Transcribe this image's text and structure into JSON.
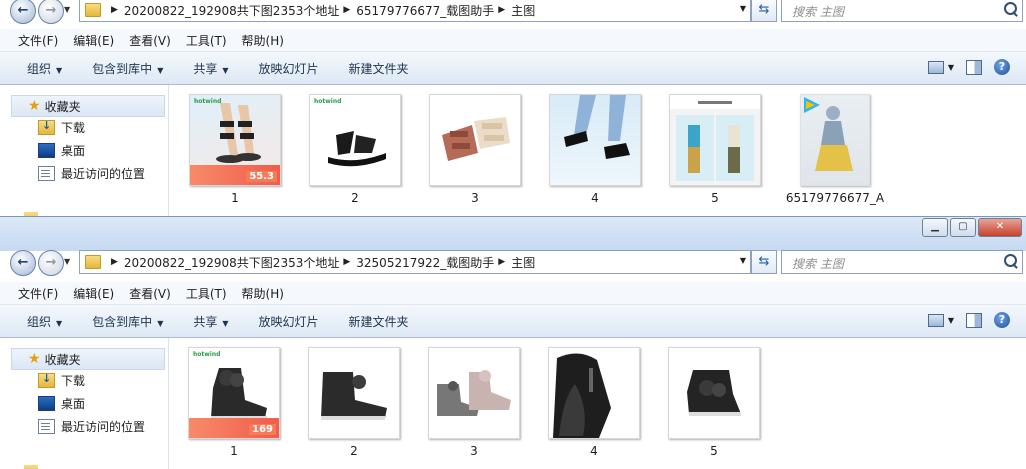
{
  "window_top": {
    "breadcrumbs": [
      "20200822_192908共下图2353个地址",
      "65179776677_载图助手",
      "主图"
    ],
    "search_placeholder": "搜索 主图",
    "menu": [
      "文件(F)",
      "编辑(E)",
      "查看(V)",
      "工具(T)",
      "帮助(H)"
    ],
    "toolbar": [
      "组织",
      "包含到库中",
      "共享",
      "放映幻灯片",
      "新建文件夹"
    ],
    "nav": {
      "favorites": "收藏夹",
      "items": [
        "下载",
        "桌面",
        "最近访问的位置"
      ]
    },
    "files": [
      {
        "label": "1",
        "thumb": "sandal-model-promo",
        "brand": "hotwind",
        "price": "55.3"
      },
      {
        "label": "2",
        "thumb": "sandal-black",
        "brand": "hotwind"
      },
      {
        "label": "3",
        "thumb": "sandal-pair"
      },
      {
        "label": "4",
        "thumb": "sandal-worn"
      },
      {
        "label": "5",
        "thumb": "model-collage"
      },
      {
        "label": "65179776677_A",
        "thumb": "video-file"
      }
    ]
  },
  "window_bottom": {
    "breadcrumbs": [
      "20200822_192908共下图2353个地址",
      "32505217922_载图助手",
      "主图"
    ],
    "search_placeholder": "搜索 主图",
    "menu": [
      "文件(F)",
      "编辑(E)",
      "查看(V)",
      "工具(T)",
      "帮助(H)"
    ],
    "toolbar": [
      "组织",
      "包含到库中",
      "共享",
      "放映幻灯片",
      "新建文件夹"
    ],
    "nav": {
      "favorites": "收藏夹",
      "items": [
        "下载",
        "桌面",
        "最近访问的位置"
      ]
    },
    "files": [
      {
        "label": "1",
        "thumb": "boot-promo",
        "brand": "hotwind",
        "price": "169"
      },
      {
        "label": "2",
        "thumb": "boot-side"
      },
      {
        "label": "3",
        "thumb": "boot-pair-pink-gray"
      },
      {
        "label": "4",
        "thumb": "boot-closeup"
      },
      {
        "label": "5",
        "thumb": "boot-back"
      }
    ]
  },
  "colors": {
    "window_frame": "#b9d1ea",
    "toolbar_top": "#f4f8fc",
    "close_button": "#c6402b",
    "promo": "#f25b4a",
    "brand": "#2b9a4a"
  }
}
